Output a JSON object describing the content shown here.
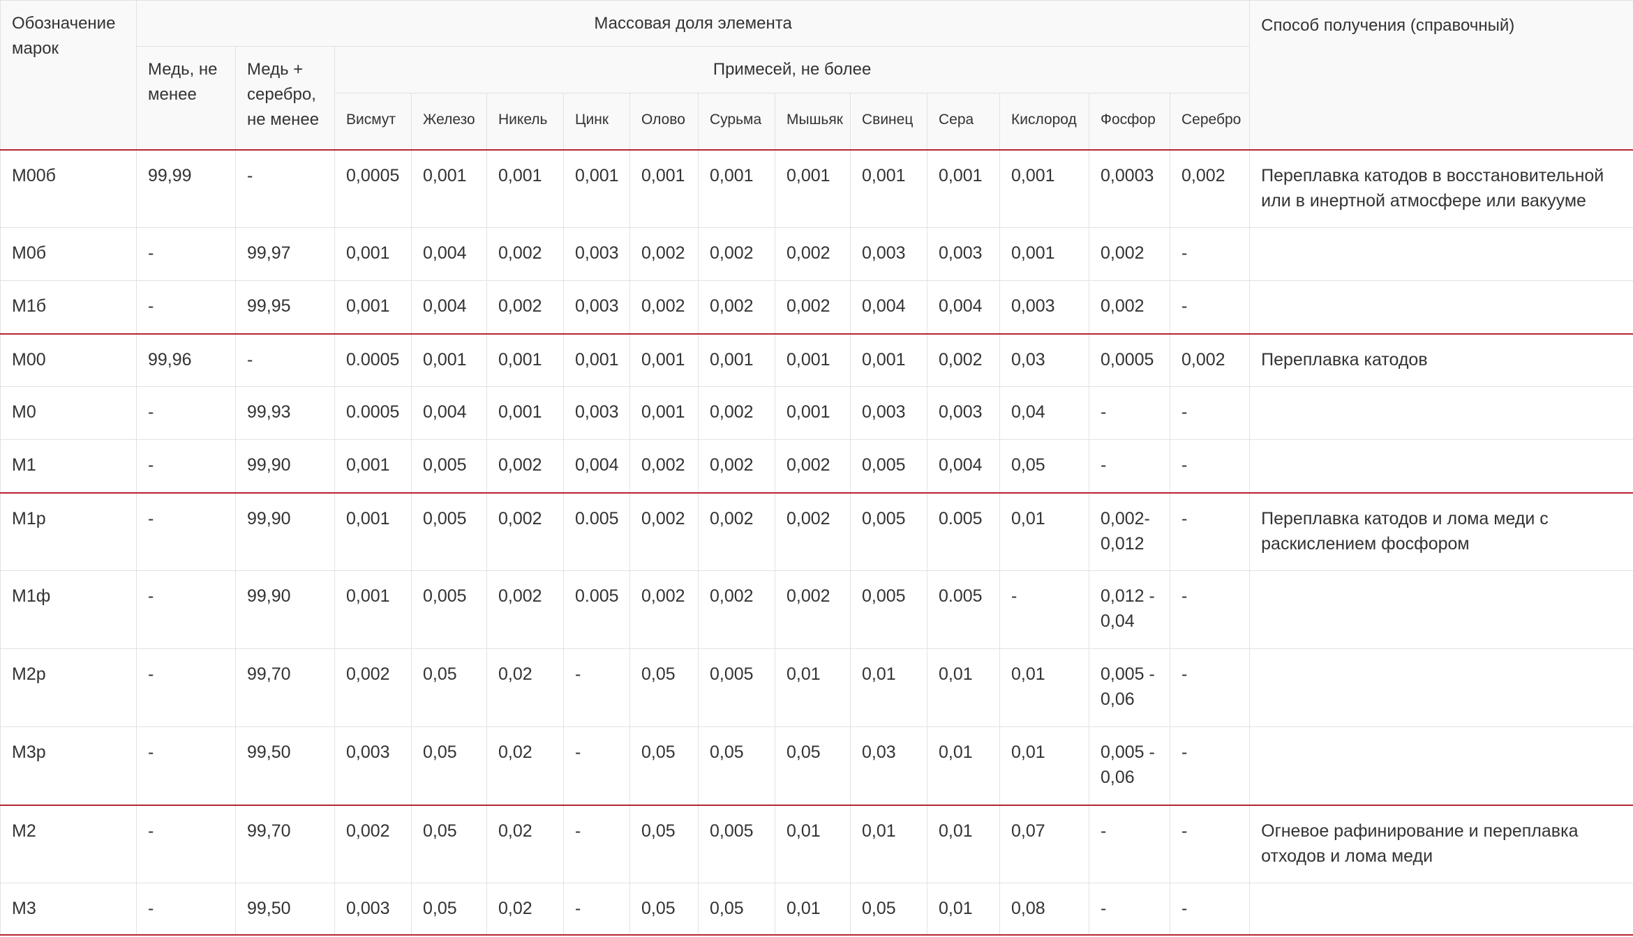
{
  "header": {
    "grade": "Обозначение марок",
    "mass_fraction": "Массовая доля элемента",
    "method": "Способ получения (справочный)",
    "copper_min": "Медь, не менее",
    "copper_silver_min": "Медь + серебро, не менее",
    "impurities_max": "Примесей, не более",
    "impurities": [
      "Висмут",
      "Железо",
      "Никель",
      "Цинк",
      "Олово",
      "Сурьма",
      "Мышьяк",
      "Свинец",
      "Сера",
      "Кислород",
      "Фосфор",
      "Серебро"
    ]
  },
  "rows": [
    {
      "grade": "М00б",
      "cu": "99,99",
      "cuag": "-",
      "imp": [
        "0,0005",
        "0,001",
        "0,001",
        "0,001",
        "0,001",
        "0,001",
        "0,001",
        "0,001",
        "0,001",
        "0,001",
        "0,0003",
        "0,002"
      ],
      "method": "Переплавка катодов в восстановительной или в инертной атмосфере или вакууме"
    },
    {
      "grade": "М0б",
      "cu": "-",
      "cuag": "99,97",
      "imp": [
        "0,001",
        "0,004",
        "0,002",
        "0,003",
        "0,002",
        "0,002",
        "0,002",
        "0,003",
        "0,003",
        "0,001",
        "0,002",
        "-"
      ],
      "method": ""
    },
    {
      "grade": "М1б",
      "cu": "-",
      "cuag": "99,95",
      "imp": [
        "0,001",
        "0,004",
        "0,002",
        "0,003",
        "0,002",
        "0,002",
        "0,002",
        "0,004",
        "0,004",
        "0,003",
        "0,002",
        "-"
      ],
      "method": ""
    },
    {
      "grade": "М00",
      "cu": "99,96",
      "cuag": "-",
      "imp": [
        "0.0005",
        "0,001",
        "0,001",
        "0,001",
        "0,001",
        "0,001",
        "0,001",
        "0,001",
        "0,002",
        "0,03",
        "0,0005",
        "0,002"
      ],
      "method": "Переплавка катодов"
    },
    {
      "grade": "М0",
      "cu": "-",
      "cuag": "99,93",
      "imp": [
        "0.0005",
        "0,004",
        "0,001",
        "0,003",
        "0,001",
        "0,002",
        "0,001",
        "0,003",
        "0,003",
        "0,04",
        "-",
        "-"
      ],
      "method": ""
    },
    {
      "grade": "М1",
      "cu": "-",
      "cuag": "99,90",
      "imp": [
        "0,001",
        "0,005",
        "0,002",
        "0,004",
        "0,002",
        "0,002",
        "0,002",
        "0,005",
        "0,004",
        "0,05",
        "-",
        "-"
      ],
      "method": ""
    },
    {
      "grade": "М1р",
      "cu": "-",
      "cuag": "99,90",
      "imp": [
        "0,001",
        "0,005",
        "0,002",
        "0.005",
        "0,002",
        "0,002",
        "0,002",
        "0,005",
        "0.005",
        "0,01",
        "0,002-0,012",
        "-"
      ],
      "method": "Переплавка катодов и лома меди с раскислением фосфором"
    },
    {
      "grade": "М1ф",
      "cu": "-",
      "cuag": "99,90",
      "imp": [
        "0,001",
        "0,005",
        "0,002",
        "0.005",
        "0,002",
        "0,002",
        "0,002",
        "0,005",
        "0.005",
        "-",
        "0,012 - 0,04",
        "-"
      ],
      "method": ""
    },
    {
      "grade": "М2р",
      "cu": "-",
      "cuag": "99,70",
      "imp": [
        "0,002",
        "0,05",
        "0,02",
        "-",
        "0,05",
        "0,005",
        "0,01",
        "0,01",
        "0,01",
        "0,01",
        "0,005 - 0,06",
        "-"
      ],
      "method": ""
    },
    {
      "grade": "М3р",
      "cu": "-",
      "cuag": "99,50",
      "imp": [
        "0,003",
        "0,05",
        "0,02",
        "-",
        "0,05",
        "0,05",
        "0,05",
        "0,03",
        "0,01",
        "0,01",
        "0,005 - 0,06",
        "-"
      ],
      "method": ""
    },
    {
      "grade": "М2",
      "cu": "-",
      "cuag": "99,70",
      "imp": [
        "0,002",
        "0,05",
        "0,02",
        "-",
        "0,05",
        "0,005",
        "0,01",
        "0,01",
        "0,01",
        "0,07",
        "-",
        "-"
      ],
      "method": "Огневое рафинирование и переплавка отходов и лома меди"
    },
    {
      "grade": "М3",
      "cu": "-",
      "cuag": "99,50",
      "imp": [
        "0,003",
        "0,05",
        "0,02",
        "-",
        "0,05",
        "0,05",
        "0,01",
        "0,05",
        "0,01",
        "0,08",
        "-",
        "-"
      ],
      "method": ""
    }
  ]
}
